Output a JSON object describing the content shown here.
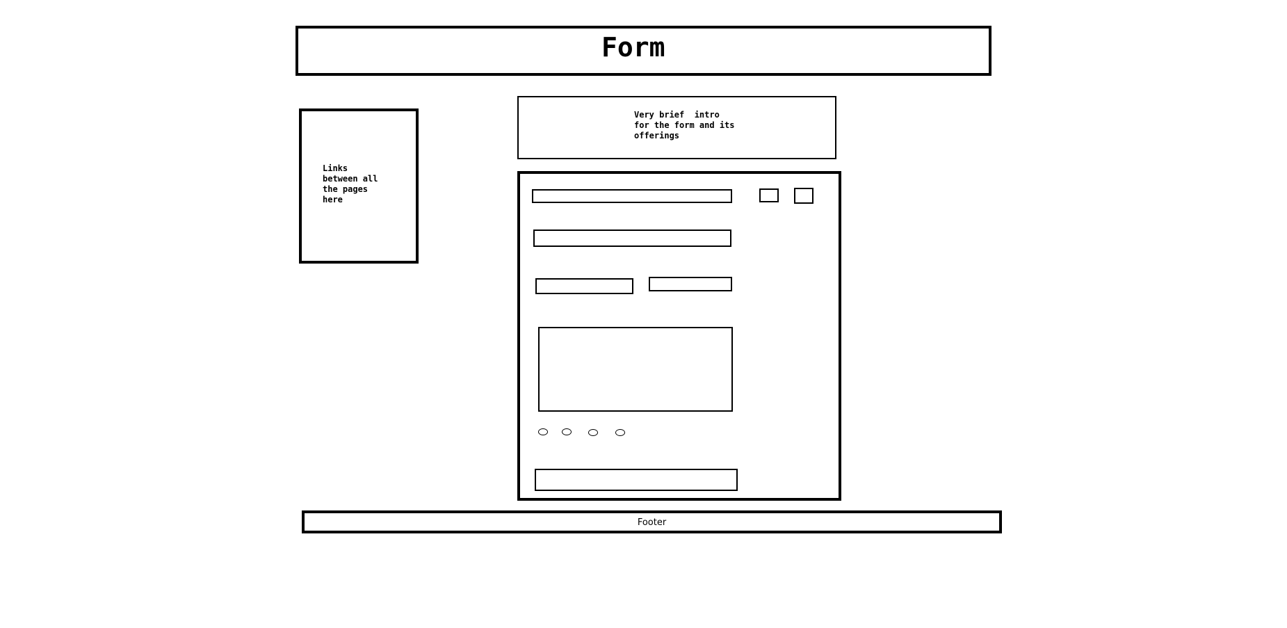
{
  "header": {
    "title": "Form"
  },
  "nav": {
    "text": "Links\nbetween all\nthe pages\nhere"
  },
  "intro": {
    "text": "Very brief  intro\nfor the form and its\nofferings"
  },
  "form": {
    "radio_options": [
      "",
      "",
      "",
      ""
    ]
  },
  "footer": {
    "text": "Footer"
  }
}
